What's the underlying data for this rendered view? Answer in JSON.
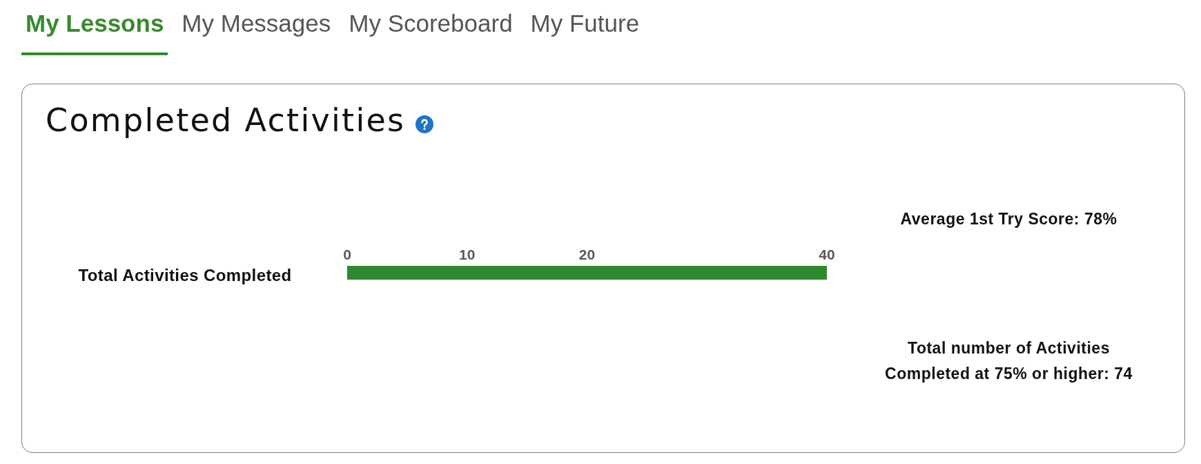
{
  "tabs": [
    {
      "label": "My Lessons",
      "selected": true
    },
    {
      "label": "My Messages",
      "selected": false
    },
    {
      "label": "My Scoreboard",
      "selected": false
    },
    {
      "label": "My Future",
      "selected": false
    }
  ],
  "card": {
    "title": "Completed Activities",
    "chart_data": {
      "type": "bar",
      "orientation": "horizontal",
      "categories": [
        "Total Activities Completed"
      ],
      "values": [
        40
      ],
      "xlim": [
        0,
        40
      ],
      "xticks": [
        0,
        10,
        20,
        40
      ]
    },
    "stats": [
      "Average 1st Try Score: 78%",
      "Total number of Activities Completed at 75% or higher: 74"
    ]
  }
}
